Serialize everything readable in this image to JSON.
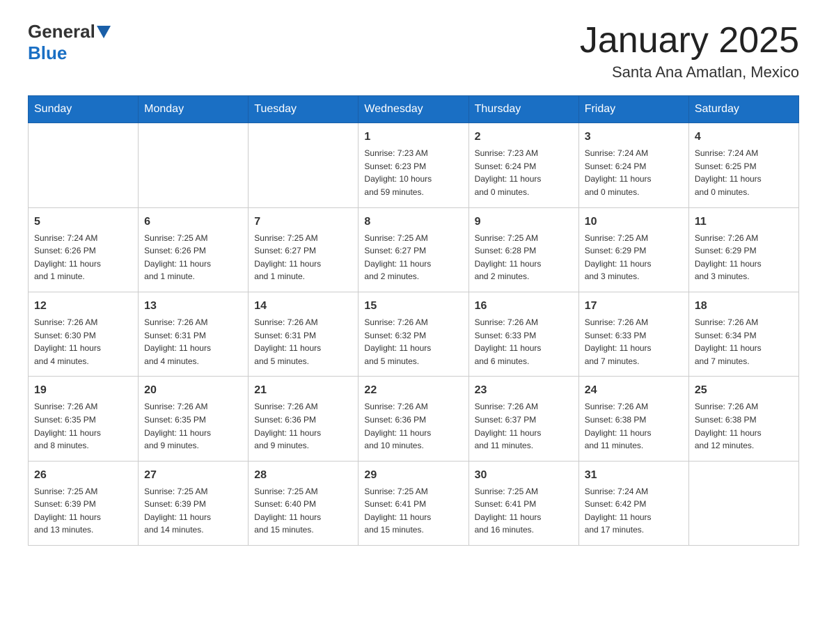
{
  "header": {
    "logo_general": "General",
    "logo_blue": "Blue",
    "month_title": "January 2025",
    "location": "Santa Ana Amatlan, Mexico"
  },
  "weekdays": [
    "Sunday",
    "Monday",
    "Tuesday",
    "Wednesday",
    "Thursday",
    "Friday",
    "Saturday"
  ],
  "weeks": [
    [
      {
        "day": "",
        "info": ""
      },
      {
        "day": "",
        "info": ""
      },
      {
        "day": "",
        "info": ""
      },
      {
        "day": "1",
        "info": "Sunrise: 7:23 AM\nSunset: 6:23 PM\nDaylight: 10 hours\nand 59 minutes."
      },
      {
        "day": "2",
        "info": "Sunrise: 7:23 AM\nSunset: 6:24 PM\nDaylight: 11 hours\nand 0 minutes."
      },
      {
        "day": "3",
        "info": "Sunrise: 7:24 AM\nSunset: 6:24 PM\nDaylight: 11 hours\nand 0 minutes."
      },
      {
        "day": "4",
        "info": "Sunrise: 7:24 AM\nSunset: 6:25 PM\nDaylight: 11 hours\nand 0 minutes."
      }
    ],
    [
      {
        "day": "5",
        "info": "Sunrise: 7:24 AM\nSunset: 6:26 PM\nDaylight: 11 hours\nand 1 minute."
      },
      {
        "day": "6",
        "info": "Sunrise: 7:25 AM\nSunset: 6:26 PM\nDaylight: 11 hours\nand 1 minute."
      },
      {
        "day": "7",
        "info": "Sunrise: 7:25 AM\nSunset: 6:27 PM\nDaylight: 11 hours\nand 1 minute."
      },
      {
        "day": "8",
        "info": "Sunrise: 7:25 AM\nSunset: 6:27 PM\nDaylight: 11 hours\nand 2 minutes."
      },
      {
        "day": "9",
        "info": "Sunrise: 7:25 AM\nSunset: 6:28 PM\nDaylight: 11 hours\nand 2 minutes."
      },
      {
        "day": "10",
        "info": "Sunrise: 7:25 AM\nSunset: 6:29 PM\nDaylight: 11 hours\nand 3 minutes."
      },
      {
        "day": "11",
        "info": "Sunrise: 7:26 AM\nSunset: 6:29 PM\nDaylight: 11 hours\nand 3 minutes."
      }
    ],
    [
      {
        "day": "12",
        "info": "Sunrise: 7:26 AM\nSunset: 6:30 PM\nDaylight: 11 hours\nand 4 minutes."
      },
      {
        "day": "13",
        "info": "Sunrise: 7:26 AM\nSunset: 6:31 PM\nDaylight: 11 hours\nand 4 minutes."
      },
      {
        "day": "14",
        "info": "Sunrise: 7:26 AM\nSunset: 6:31 PM\nDaylight: 11 hours\nand 5 minutes."
      },
      {
        "day": "15",
        "info": "Sunrise: 7:26 AM\nSunset: 6:32 PM\nDaylight: 11 hours\nand 5 minutes."
      },
      {
        "day": "16",
        "info": "Sunrise: 7:26 AM\nSunset: 6:33 PM\nDaylight: 11 hours\nand 6 minutes."
      },
      {
        "day": "17",
        "info": "Sunrise: 7:26 AM\nSunset: 6:33 PM\nDaylight: 11 hours\nand 7 minutes."
      },
      {
        "day": "18",
        "info": "Sunrise: 7:26 AM\nSunset: 6:34 PM\nDaylight: 11 hours\nand 7 minutes."
      }
    ],
    [
      {
        "day": "19",
        "info": "Sunrise: 7:26 AM\nSunset: 6:35 PM\nDaylight: 11 hours\nand 8 minutes."
      },
      {
        "day": "20",
        "info": "Sunrise: 7:26 AM\nSunset: 6:35 PM\nDaylight: 11 hours\nand 9 minutes."
      },
      {
        "day": "21",
        "info": "Sunrise: 7:26 AM\nSunset: 6:36 PM\nDaylight: 11 hours\nand 9 minutes."
      },
      {
        "day": "22",
        "info": "Sunrise: 7:26 AM\nSunset: 6:36 PM\nDaylight: 11 hours\nand 10 minutes."
      },
      {
        "day": "23",
        "info": "Sunrise: 7:26 AM\nSunset: 6:37 PM\nDaylight: 11 hours\nand 11 minutes."
      },
      {
        "day": "24",
        "info": "Sunrise: 7:26 AM\nSunset: 6:38 PM\nDaylight: 11 hours\nand 11 minutes."
      },
      {
        "day": "25",
        "info": "Sunrise: 7:26 AM\nSunset: 6:38 PM\nDaylight: 11 hours\nand 12 minutes."
      }
    ],
    [
      {
        "day": "26",
        "info": "Sunrise: 7:25 AM\nSunset: 6:39 PM\nDaylight: 11 hours\nand 13 minutes."
      },
      {
        "day": "27",
        "info": "Sunrise: 7:25 AM\nSunset: 6:39 PM\nDaylight: 11 hours\nand 14 minutes."
      },
      {
        "day": "28",
        "info": "Sunrise: 7:25 AM\nSunset: 6:40 PM\nDaylight: 11 hours\nand 15 minutes."
      },
      {
        "day": "29",
        "info": "Sunrise: 7:25 AM\nSunset: 6:41 PM\nDaylight: 11 hours\nand 15 minutes."
      },
      {
        "day": "30",
        "info": "Sunrise: 7:25 AM\nSunset: 6:41 PM\nDaylight: 11 hours\nand 16 minutes."
      },
      {
        "day": "31",
        "info": "Sunrise: 7:24 AM\nSunset: 6:42 PM\nDaylight: 11 hours\nand 17 minutes."
      },
      {
        "day": "",
        "info": ""
      }
    ]
  ]
}
